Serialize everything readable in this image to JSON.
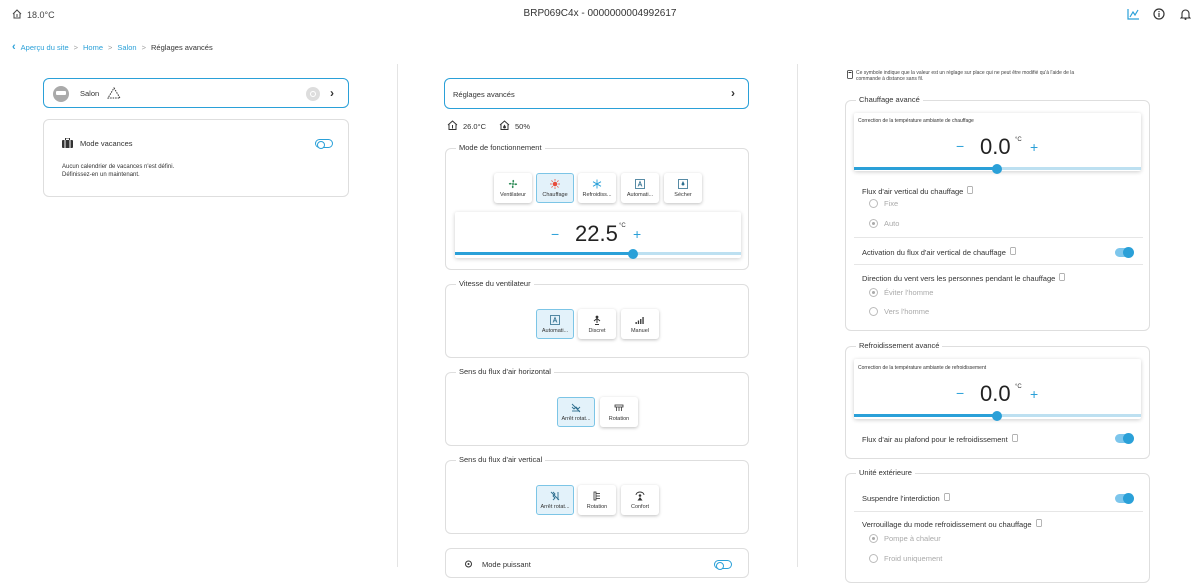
{
  "header": {
    "temp": "18.0°C",
    "device": "BRP069C4x - 0000000004992617"
  },
  "breadcrumb": {
    "items": [
      "Aperçu du site",
      "Home",
      "Salon",
      "Réglages avancés"
    ]
  },
  "left": {
    "room_name": "Salon",
    "vacation_label": "Mode vacances",
    "vacation_text_1": "Aucun calendrier de vacances n'est défini.",
    "vacation_text_2": "Définissez-en un maintenant."
  },
  "middle": {
    "settings_label": "Réglages avancés",
    "indoor_temp": "26.0°C",
    "humidity": "50%",
    "mode_title": "Mode de fonctionnement",
    "modes": [
      "Ventilateur",
      "Chauffage",
      "Refroidiss...",
      "Automati...",
      "Sécher"
    ],
    "setpoint": "22.5",
    "unit": "°C",
    "minus": "−",
    "plus": "+",
    "fan_title": "Vitesse du ventilateur",
    "fan_modes": [
      "Automati...",
      "Discret",
      "Manuel"
    ],
    "hswing_title": "Sens du flux d'air horizontal",
    "hswing": [
      "Arrêt rotat...",
      "Rotation"
    ],
    "vswing_title": "Sens du flux d'air vertical",
    "vswing": [
      "Arrêt rotat...",
      "Rotation",
      "Confort"
    ],
    "powerful": "Mode puissant"
  },
  "right": {
    "note_1": "Ce symbole indique que la valeur est un réglage sur place qui ne peut être modifié qu'à l'aide de la",
    "note_2": "commande à distance sans fil.",
    "heat_title": "Chauffage avancé",
    "heat_corr": "Correction de la température ambiante de chauffage",
    "heat_val": "0.0",
    "heat_vflow": "Flux d'air vertical du chauffage",
    "opt_fixe": "Fixe",
    "opt_auto": "Auto",
    "heat_vflow_act": "Activation du flux d'air vertical de chauffage",
    "wind_dir": "Direction du vent vers les personnes pendant le chauffage",
    "opt_avoid": "Éviter l'homme",
    "opt_towards": "Vers l'homme",
    "cool_title": "Refroidissement avancé",
    "cool_corr": "Correction de la température ambiante de refroidissement",
    "cool_val": "0.0",
    "ceiling": "Flux d'air au plafond pour le refroidissement",
    "outdoor_title": "Unité extérieure",
    "suspend": "Suspendre l'interdiction",
    "lock": "Verrouillage du mode refroidissement ou chauffage",
    "opt_heatpump": "Pompe à chaleur",
    "opt_coldonly": "Froid uniquement",
    "unit": "°C",
    "minus": "−",
    "plus": "+"
  },
  "colors": {
    "accent": "#2aa0d8",
    "heat": "#e74c3c",
    "fan": "#2e8b57"
  },
  "state": {
    "heat_vflow_act": true,
    "ceiling": true,
    "suspend": true,
    "vacation": false,
    "powerful": false,
    "selected_mode": "Chauffage"
  }
}
